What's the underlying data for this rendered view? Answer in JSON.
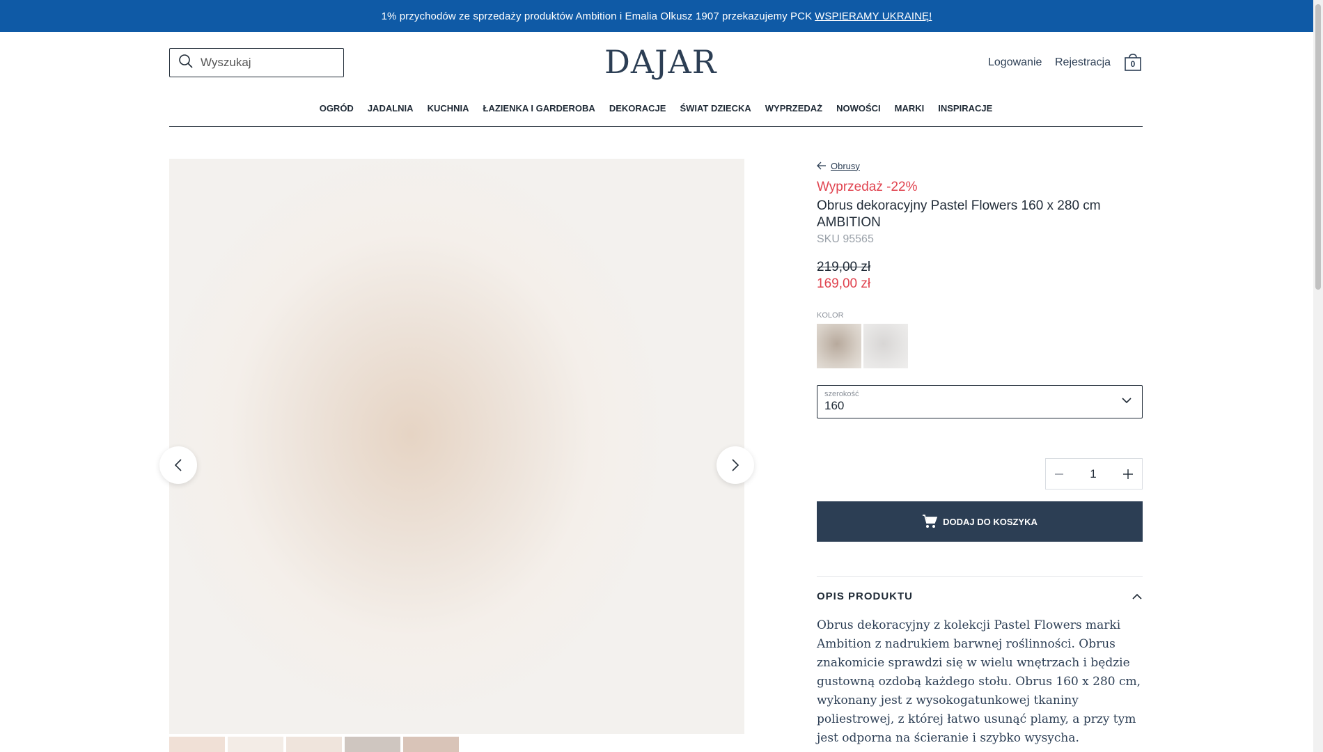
{
  "banner": {
    "text": "1% przychodów ze sprzedaży produktów Ambition i Emalia Olkusz 1907 przekazujemy PCK",
    "link": "WSPIERAMY UKRAINĘ!"
  },
  "header": {
    "search_placeholder": "Wyszukaj",
    "logo": "DAJAR",
    "login": "Logowanie",
    "register": "Rejestracja",
    "cart_count": "0"
  },
  "nav": [
    "OGRÓD",
    "JADALNIA",
    "KUCHNIA",
    "ŁAZIENKA I GARDEROBA",
    "DEKORACJE",
    "ŚWIAT DZIECKA",
    "WYPRZEDAŻ",
    "NOWOŚCI",
    "MARKI",
    "INSPIRACJE"
  ],
  "product": {
    "breadcrumb": "Obrusy",
    "sale_badge": "Wyprzedaż -22%",
    "title": "Obrus dekoracyjny Pastel Flowers 160 x 280 cm AMBITION",
    "sku": "SKU 95565",
    "old_price": "219,00 zł",
    "new_price": "169,00 zł",
    "color_label": "KOLOR",
    "width_label": "szerokość",
    "width_value": "160",
    "quantity": "1",
    "add_to_cart": "DODAJ DO KOSZYKA",
    "description_heading": "OPIS PRODUKTU",
    "description": "Obrus dekoracyjny z kolekcji Pastel Flowers marki Ambition z nadrukiem barwnej roślinności. Obrus znakomicie sprawdzi się w wielu wnętrzach i będzie gustowną ozdobą każdego stołu. Obrus 160 x 280 cm, wykonany jest z wysokogatunkowej tkaniny poliestrowej, z której łatwo usunąć plamy, a przy tym jest odporna na ścieranie i szybko wysycha."
  },
  "colors": {
    "accent": "#2c3e54",
    "sale": "#e0434f",
    "banner": "#0f5aa6"
  }
}
